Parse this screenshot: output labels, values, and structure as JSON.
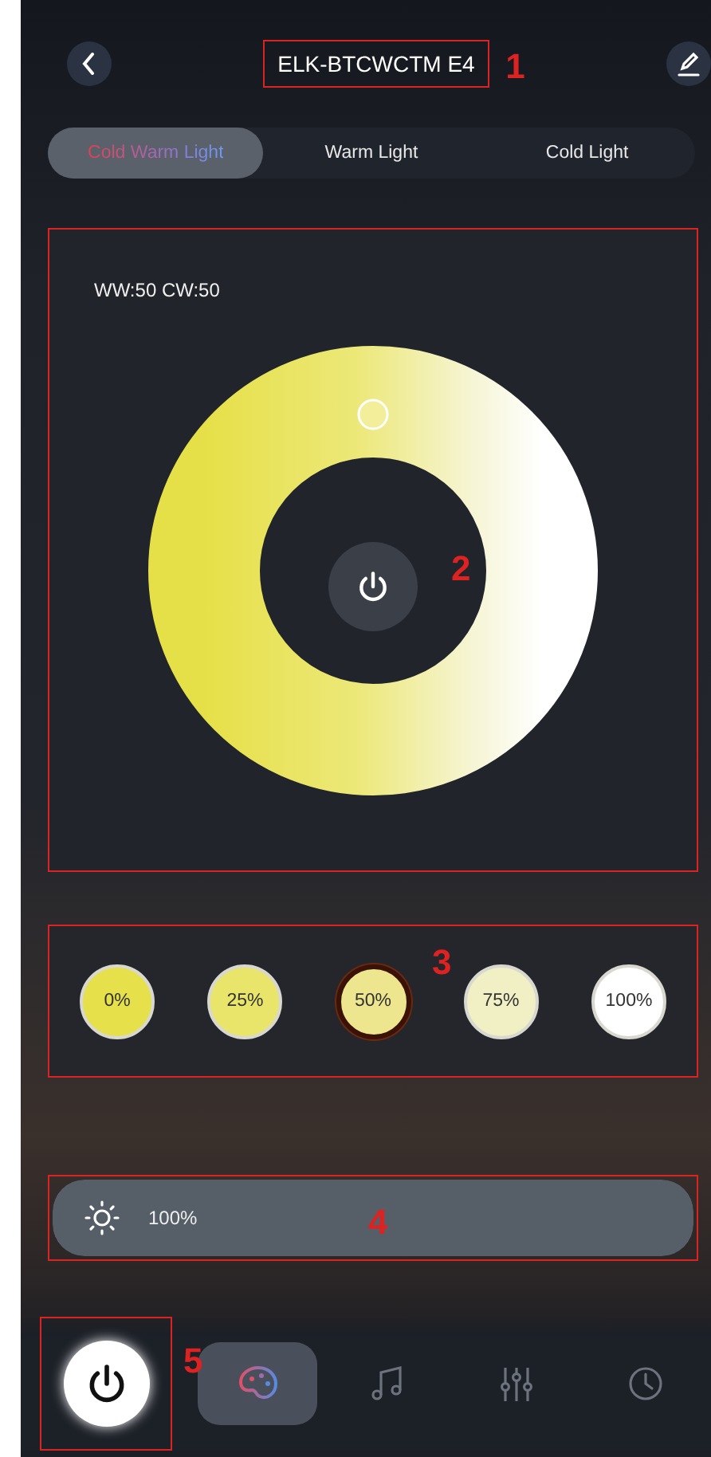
{
  "header": {
    "title": "ELK-BTCWCTM E4",
    "callout": "1"
  },
  "tabs": [
    {
      "label": "Cold Warm Light",
      "selected": true
    },
    {
      "label": "Warm Light",
      "selected": false
    },
    {
      "label": "Cold Light",
      "selected": false
    }
  ],
  "panel": {
    "reading": "WW:50 CW:50",
    "callout": "2"
  },
  "presets": {
    "callout": "3",
    "items": [
      {
        "label": "0%",
        "color": "#e6e04a",
        "selected": false
      },
      {
        "label": "25%",
        "color": "#e9e56a",
        "selected": false
      },
      {
        "label": "50%",
        "color": "#eee68e",
        "selected": true
      },
      {
        "label": "75%",
        "color": "#f1f0c4",
        "selected": false
      },
      {
        "label": "100%",
        "color": "#ffffff",
        "selected": false
      }
    ]
  },
  "brightness": {
    "reading": "100%",
    "level": 1,
    "callout": "4"
  },
  "nav": {
    "callout": "5",
    "items": [
      {
        "kind": "palette",
        "selected": true
      },
      {
        "kind": "music",
        "selected": false
      },
      {
        "kind": "sliders",
        "selected": false
      },
      {
        "kind": "clock",
        "selected": false
      }
    ]
  }
}
